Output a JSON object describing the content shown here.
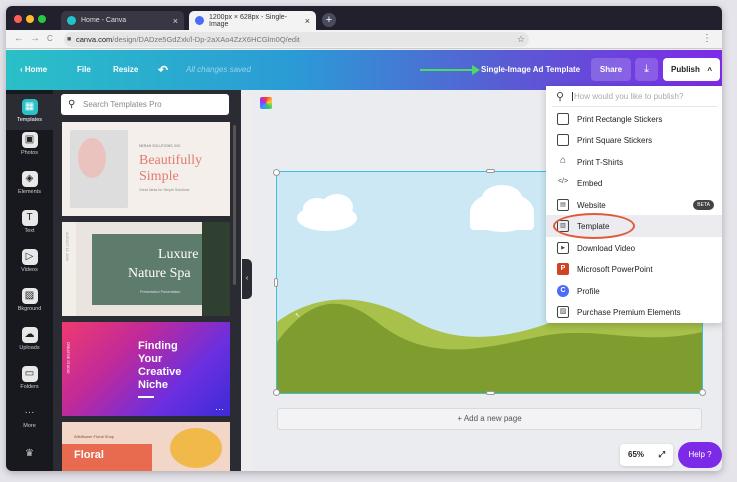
{
  "browser": {
    "tabs": [
      {
        "label": "Home - Canva"
      },
      {
        "label": "1200px × 628px - Single-Image"
      }
    ],
    "new_tab": "+",
    "close": "×",
    "nav": {
      "back": "←",
      "forward": "→",
      "reload": "C"
    },
    "url_host": "canva.com",
    "url_path": "/design/DADze5GdZxk/l-Dp-2aXAo4ZzX6HCGlm0Q/edit",
    "star": "☆"
  },
  "header": {
    "home": "‹ Home",
    "file": "File",
    "resize": "Resize",
    "undo": "↶",
    "status": "All changes saved",
    "design_title": "Single-Image Ad Template",
    "share": "Share",
    "download": "⤓",
    "publish": "Publish",
    "publish_chevron": "^"
  },
  "iconbar": [
    {
      "label": "Templates",
      "glyph": "▦"
    },
    {
      "label": "Photos",
      "glyph": "▣"
    },
    {
      "label": "Elements",
      "glyph": "◈"
    },
    {
      "label": "Text",
      "glyph": "T"
    },
    {
      "label": "Videos",
      "glyph": "▷"
    },
    {
      "label": "Bkground",
      "glyph": "▨"
    },
    {
      "label": "Uploads",
      "glyph": "☁"
    },
    {
      "label": "Folders",
      "glyph": "▭"
    },
    {
      "label": "More",
      "glyph": "···"
    },
    {
      "label": "",
      "glyph": "♛"
    }
  ],
  "panel": {
    "search_placeholder": "Search Templates Pro",
    "templates": [
      {
        "small": "NERAH SOLUTIONS, INC.",
        "title1": "Beautifully",
        "title2": "Simple",
        "sub": "Great Ideas for Simple Solutions"
      },
      {
        "side": "AUGUST 14, 2030",
        "title1": "Luxure",
        "title2": "Nature Spa",
        "sub": "Presentation Presentation"
      },
      {
        "title1": "Finding",
        "title2": "Your",
        "title3": "Creative",
        "title4": "Niche",
        "side": "CREATIVE STUDIO",
        "more": "···"
      },
      {
        "small": "Wildflower Floral Shop",
        "title1": "Floral"
      }
    ],
    "collapse": "‹"
  },
  "canvas": {
    "add_page": "+ Add a new page",
    "zoom": "65%",
    "expand": "⤢",
    "help": "Help ?"
  },
  "publish_menu": {
    "search_placeholder": "How would you like to publish?",
    "items": [
      {
        "label": "Print Rectangle Stickers",
        "icon": "sticker-icon",
        "glyph": ""
      },
      {
        "label": "Print Square Stickers",
        "icon": "sticker-icon",
        "glyph": ""
      },
      {
        "label": "Print T-Shirts",
        "icon": "tshirt-icon",
        "glyph": "⌂"
      },
      {
        "label": "Embed",
        "icon": "code-icon",
        "glyph": "</>"
      },
      {
        "label": "Website",
        "icon": "website-icon",
        "glyph": "▤",
        "badge": "BETA"
      },
      {
        "label": "Template",
        "icon": "template-icon",
        "glyph": "▥"
      },
      {
        "label": "Download Video",
        "icon": "video-icon",
        "glyph": "▶"
      },
      {
        "label": "Microsoft PowerPoint",
        "icon": "powerpoint-icon",
        "glyph": "P"
      },
      {
        "label": "Profile",
        "icon": "profile-icon",
        "glyph": "C"
      },
      {
        "label": "Purchase Premium Elements",
        "icon": "image-icon",
        "glyph": "▨"
      }
    ]
  },
  "colors": {
    "accent_purple": "#7d2ae8",
    "accent_teal": "#2ac0c7",
    "annotation_arrow": "#4cd964",
    "annotation_circle": "#e05a3a"
  }
}
